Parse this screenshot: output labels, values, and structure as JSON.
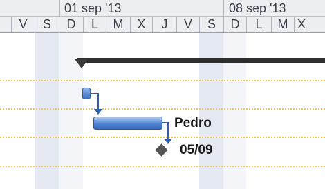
{
  "timescale": {
    "weeks": [
      {
        "label": "01 sep '13"
      },
      {
        "label": "08 sep '13"
      }
    ],
    "days": [
      "V",
      "S",
      "D",
      "L",
      "M",
      "X",
      "J",
      "V",
      "S",
      "D",
      "L",
      "M",
      "X"
    ]
  },
  "tasks": {
    "main_task_resource": "Pedro",
    "milestone_date": "05/09"
  },
  "colors": {
    "task_bar": "#4a7fd0",
    "summary_bar": "#2e2e2e",
    "milestone": "#555555",
    "gridline": "#f2c94c",
    "nonworking": "#e4e9f1"
  }
}
